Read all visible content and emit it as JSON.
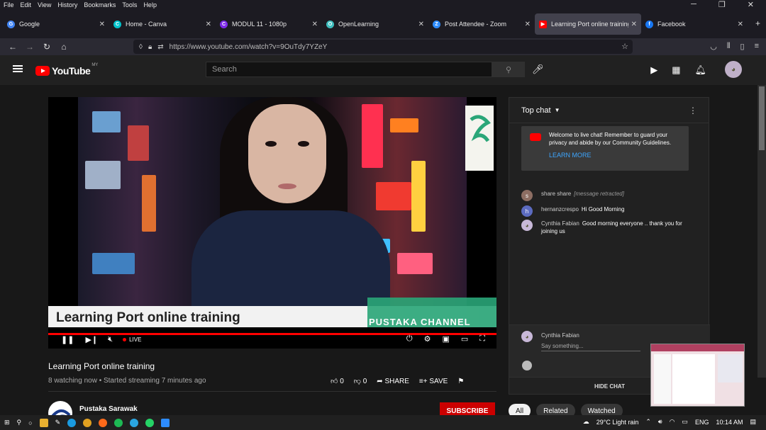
{
  "menubar": {
    "items": [
      "File",
      "Edit",
      "View",
      "History",
      "Bookmarks",
      "Tools",
      "Help"
    ]
  },
  "tabs": [
    {
      "label": "Google",
      "color": "#4285f4",
      "glyph": "G"
    },
    {
      "label": "Home - Canva",
      "color": "#00c4cc",
      "glyph": "C"
    },
    {
      "label": "MODUL 11 - 1080p",
      "color": "#7d2ae8",
      "glyph": "C"
    },
    {
      "label": "OpenLearning",
      "color": "#3fbfbf",
      "glyph": "O"
    },
    {
      "label": "Post Attendee - Zoom",
      "color": "#2d8cff",
      "glyph": "Z"
    },
    {
      "label": "Learning Port online training",
      "color": "#ff0000",
      "glyph": "▶"
    },
    {
      "label": "Facebook",
      "color": "#1877f2",
      "glyph": "f"
    }
  ],
  "url": "https://www.youtube.com/watch?v=9OuTdy7YZeY",
  "youtube": {
    "logo_text": "YouTube",
    "country": "MY",
    "search_placeholder": "Search"
  },
  "video": {
    "lower_third": "Learning Port online training",
    "channel_banner": "PUSTAKA CHANNEL",
    "live_label": "LIVE",
    "title": "Learning Port online training",
    "meta": "8 watching now • Started streaming 7 minutes ago",
    "likes": "0",
    "dislikes": "0",
    "share_label": "SHARE",
    "save_label": "SAVE"
  },
  "channel": {
    "name": "Pustaka Sarawak",
    "subscribe_label": "SUBSCRIBE"
  },
  "chat": {
    "header": "Top chat",
    "welcome": "Welcome to live chat! Remember to guard your privacy and abide by our Community Guidelines.",
    "learn_more": "LEARN MORE",
    "messages": [
      {
        "author": "share share",
        "text": "[message retracted]",
        "avatar": "s",
        "avatar_color": "#8d6e63"
      },
      {
        "author": "hernanzcrespo",
        "text": "Hi Good Morning",
        "avatar": "h",
        "avatar_color": "#5c6bc0"
      },
      {
        "author": "Cynthia Fabian",
        "text": "Good morning everyone .. thank you for joining us",
        "avatar": "",
        "avatar_color": "#c8b8d8"
      }
    ],
    "input_author": "Cynthia Fabian",
    "input_placeholder": "Say something...",
    "hide_chat": "HIDE CHAT"
  },
  "chips": [
    "All",
    "Related",
    "Watched"
  ],
  "taskbar": {
    "weather": "29°C  Light rain",
    "lang": "ENG",
    "time": "10:14 AM"
  }
}
